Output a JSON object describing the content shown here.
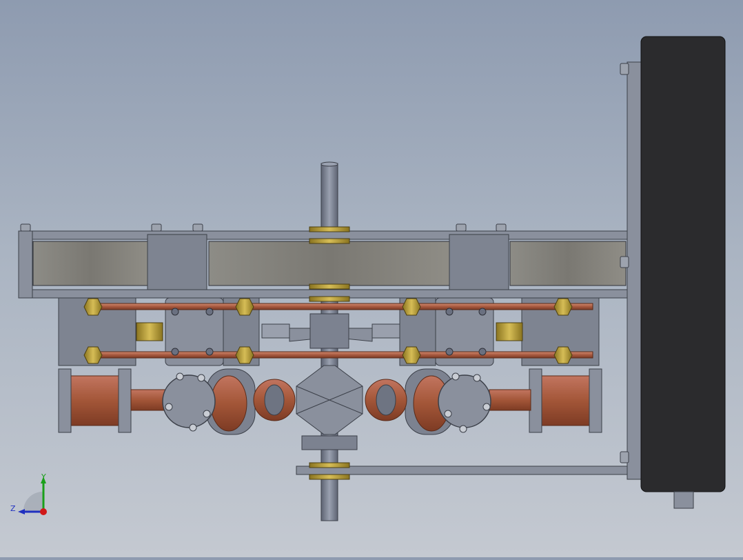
{
  "triad": {
    "axis_y": "Y",
    "axis_z": "Z"
  },
  "colors": {
    "background_top": "#8e9bb0",
    "background_bottom": "#c4c9d1",
    "steel": "#7c8290",
    "steel_light": "#9aa0ad",
    "steel_dark": "#555a66",
    "copper": "#a85a40",
    "brass": "#b39a35",
    "tank_glass": "#85847d",
    "black_box": "#2b2b2d",
    "axis_y": "#1aa01a",
    "axis_z": "#2030c0",
    "axis_x": "#d01818"
  },
  "icons": [
    "view-triad-icon"
  ]
}
